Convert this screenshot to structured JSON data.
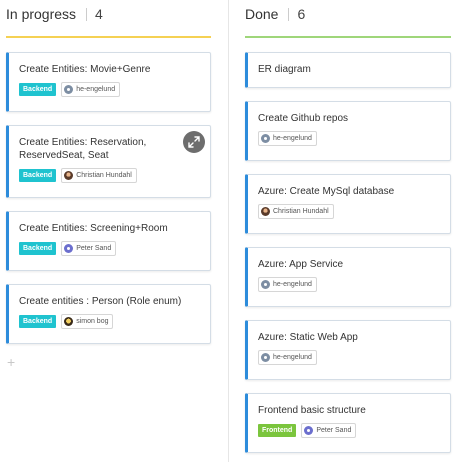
{
  "columns": [
    {
      "title": "In progress",
      "count": "4",
      "cards": [
        {
          "title": "Create Entities: Movie+Genre",
          "label": "Backend",
          "assignee": "he-engelund"
        },
        {
          "title": "Create Entities: Reservation, ReservedSeat, Seat",
          "label": "Backend",
          "assignee": "Christian Hundahl"
        },
        {
          "title": "Create Entities: Screening+Room",
          "label": "Backend",
          "assignee": "Peter Sand"
        },
        {
          "title": "Create entities : Person (Role enum)",
          "label": "Backend",
          "assignee": "simon bog"
        }
      ],
      "add_symbol": "+"
    },
    {
      "title": "Done",
      "count": "6",
      "cards": [
        {
          "title": "ER diagram"
        },
        {
          "title": "Create Github repos",
          "assignee": "he-engelund"
        },
        {
          "title": "Azure: Create MySql database",
          "assignee": "Christian Hundahl"
        },
        {
          "title": "Azure: App Service",
          "assignee": "he-engelund"
        },
        {
          "title": "Azure: Static Web App",
          "assignee": "he-engelund"
        },
        {
          "title": "Frontend basic structure",
          "label": "Frontend",
          "assignee": "Peter Sand"
        }
      ]
    }
  ],
  "colors": {
    "in_progress_line": "#f5d153",
    "done_line": "#9fd67a",
    "card_accent": "#2d8cdb",
    "backend_label": "#1fc3cf",
    "frontend_label": "#7bc53d",
    "expand_button": "#6d6d6d"
  },
  "icons": {
    "expand": "expand-arrows-icon",
    "avatar_default": "avatar-icon"
  }
}
